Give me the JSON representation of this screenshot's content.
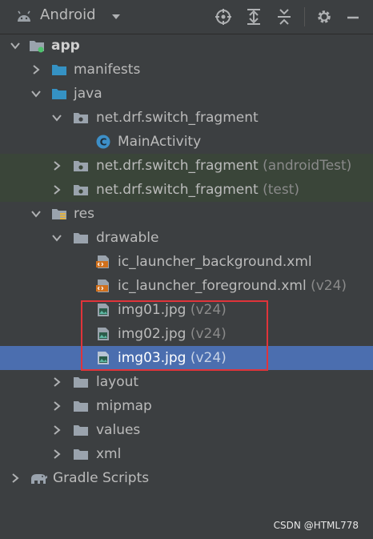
{
  "toolbar": {
    "title": "Android",
    "icons": [
      "android-icon",
      "dropdown-icon",
      "locate-icon",
      "expand-all-icon",
      "collapse-all-icon",
      "gear-icon",
      "minimize-icon"
    ]
  },
  "tree": {
    "app": "app",
    "manifests": "manifests",
    "java": "java",
    "pkg_main": "net.drf.switch_fragment",
    "main_activity": "MainActivity",
    "pkg_android_test": "net.drf.switch_fragment",
    "pkg_android_test_suffix": "(androidTest)",
    "pkg_test": "net.drf.switch_fragment",
    "pkg_test_suffix": "(test)",
    "res": "res",
    "drawable": "drawable",
    "ic_bg": "ic_launcher_background.xml",
    "ic_fg": "ic_launcher_foreground.xml",
    "ic_fg_suffix": "(v24)",
    "img01": "img01.jpg",
    "img01_suffix": "(v24)",
    "img02": "img02.jpg",
    "img02_suffix": "(v24)",
    "img03": "img03.jpg",
    "img03_suffix": "(v24)",
    "layout": "layout",
    "mipmap": "mipmap",
    "values": "values",
    "xml": "xml",
    "gradle": "Gradle Scripts"
  },
  "watermark": "CSDN @HTML778",
  "colors": {
    "background": "#3c3f41",
    "selected_row": "#4b6eaf",
    "test_row": "#3a4539",
    "highlight_box": "#e0343a",
    "module_dot": "#4ec26d"
  }
}
